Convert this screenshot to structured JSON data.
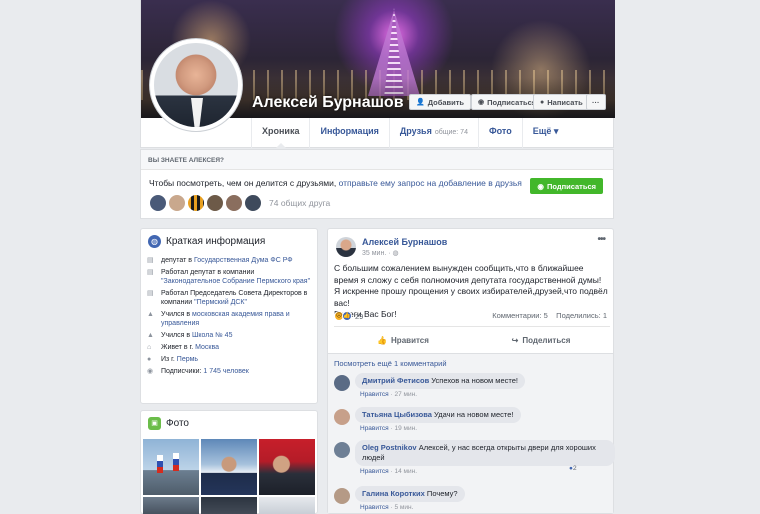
{
  "profile": {
    "name": "Алексей Бурнашов",
    "buttons": {
      "add_friend": "Добавить",
      "follow": "Подписаться",
      "message": "Написать",
      "more": "···"
    },
    "tabs": [
      {
        "label": "Хроника"
      },
      {
        "label": "Информация"
      },
      {
        "label": "Друзья",
        "count": "общие: 74"
      },
      {
        "label": "Фото"
      },
      {
        "label": "Ещё ▾"
      }
    ]
  },
  "know": {
    "heading": "ВЫ ЗНАЕТЕ АЛЕКСЕЯ?",
    "text_prefix": "Чтобы посмотреть, чем он делится с друзьями,",
    "text_link": "отправьте ему запрос на добавление в друзья",
    "subscribe_button": "Подписаться",
    "mutual_friends": "74 общих друга"
  },
  "intro": {
    "title": "Краткая информация",
    "items": [
      {
        "icon": "briefcase-icon",
        "prefix": "депутат в",
        "link": "Государственная Дума ФС РФ",
        "suffix": ""
      },
      {
        "icon": "briefcase-icon",
        "prefix": "Работал депутат в компании",
        "link": "\"Законодательное Собрание Пермского края\"",
        "suffix": ""
      },
      {
        "icon": "briefcase-icon",
        "prefix": "Работал Председатель Совета Директоров в компании",
        "link": "\"Пермский ДСК\"",
        "suffix": ""
      },
      {
        "icon": "education-icon",
        "prefix": "Учился в",
        "link": "московская академия права и управления",
        "suffix": ""
      },
      {
        "icon": "education-icon",
        "prefix": "Учился в",
        "link": "Школа № 45",
        "suffix": ""
      },
      {
        "icon": "home-icon",
        "prefix": "Живет в г.",
        "link": "Москва",
        "suffix": ""
      },
      {
        "icon": "location-icon",
        "prefix": "Из г.",
        "link": "Пермь",
        "suffix": ""
      },
      {
        "icon": "rss-icon",
        "prefix": "Подписчики:",
        "link": "1 745 человек",
        "suffix": ""
      }
    ]
  },
  "photos": {
    "title": "Фото"
  },
  "post": {
    "author": "Алексей Бурнашов",
    "time": "35 мин. · ",
    "text": "С большим сожалением вынужден сообщить,что в ближайшее время я сложу с себя полномочия депутата государственной думы!\nЯ искренне прошу прощения у своих избирателей,друзей,что подвёл вас!\nБереги Вас Бог!",
    "reactions_count": "29",
    "comments_count": "Комментарии: 5",
    "shares_count": "Поделились: 1",
    "like_label": "Нравится",
    "share_label": "Поделиться",
    "more_comments": "Посмотреть ещё 1 комментарий",
    "comments": [
      {
        "name": "Дмитрий Фетисов",
        "text": "Успехов на новом месте!",
        "like": "Нравится",
        "time": "27 мин."
      },
      {
        "name": "Татьяна Цыбизова",
        "text": "Удачи на новом месте!",
        "like": "Нравится",
        "time": "19 мин."
      },
      {
        "name": "Oleg Postnikov",
        "text": "Алексей, у нас всегда открыты двери для хороших людей",
        "like": "Нравится",
        "time": "14 мин.",
        "reactions": "2"
      },
      {
        "name": "Галина Коротких",
        "text": "Почему?",
        "like": "Нравится",
        "time": "5 мин."
      }
    ]
  }
}
